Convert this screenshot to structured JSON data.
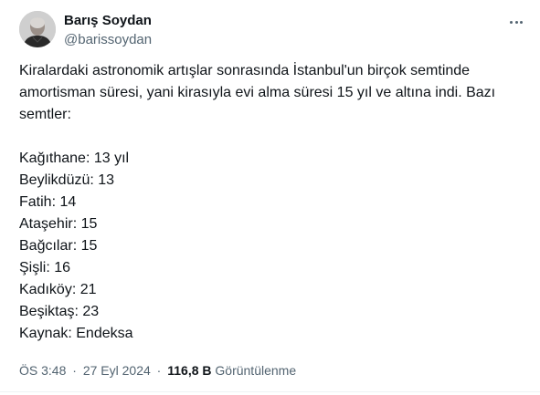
{
  "author": {
    "display_name": "Barış Soydan",
    "handle": "@barissoydan"
  },
  "tweet": {
    "intro_lines": [
      "Kiralardaki astronomik artışlar sonrasında İstanbul'un birçok semtinde",
      "amortisman süresi, yani kirasıyla evi alma süresi 15 yıl ve altına indi. Bazı",
      "semtler:"
    ],
    "districts": [
      "Kağıthane: 13 yıl",
      "Beylikdüzü: 13",
      "Fatih: 14",
      "Ataşehir: 15",
      "Bağcılar: 15",
      "Şişli: 16",
      "Kadıköy: 21",
      "Beşiktaş: 23"
    ],
    "source": "Kaynak: Endeksa"
  },
  "meta": {
    "time": "ÖS 3:48",
    "separator": "·",
    "date": "27 Eyl 2024",
    "views_count": "116,8 B",
    "views_label": "Görüntülenme"
  },
  "icons": {
    "more": "more-horizontal-icon"
  },
  "colors": {
    "text_primary": "#0f1419",
    "text_secondary": "#536471",
    "divider": "#eff3f4"
  }
}
